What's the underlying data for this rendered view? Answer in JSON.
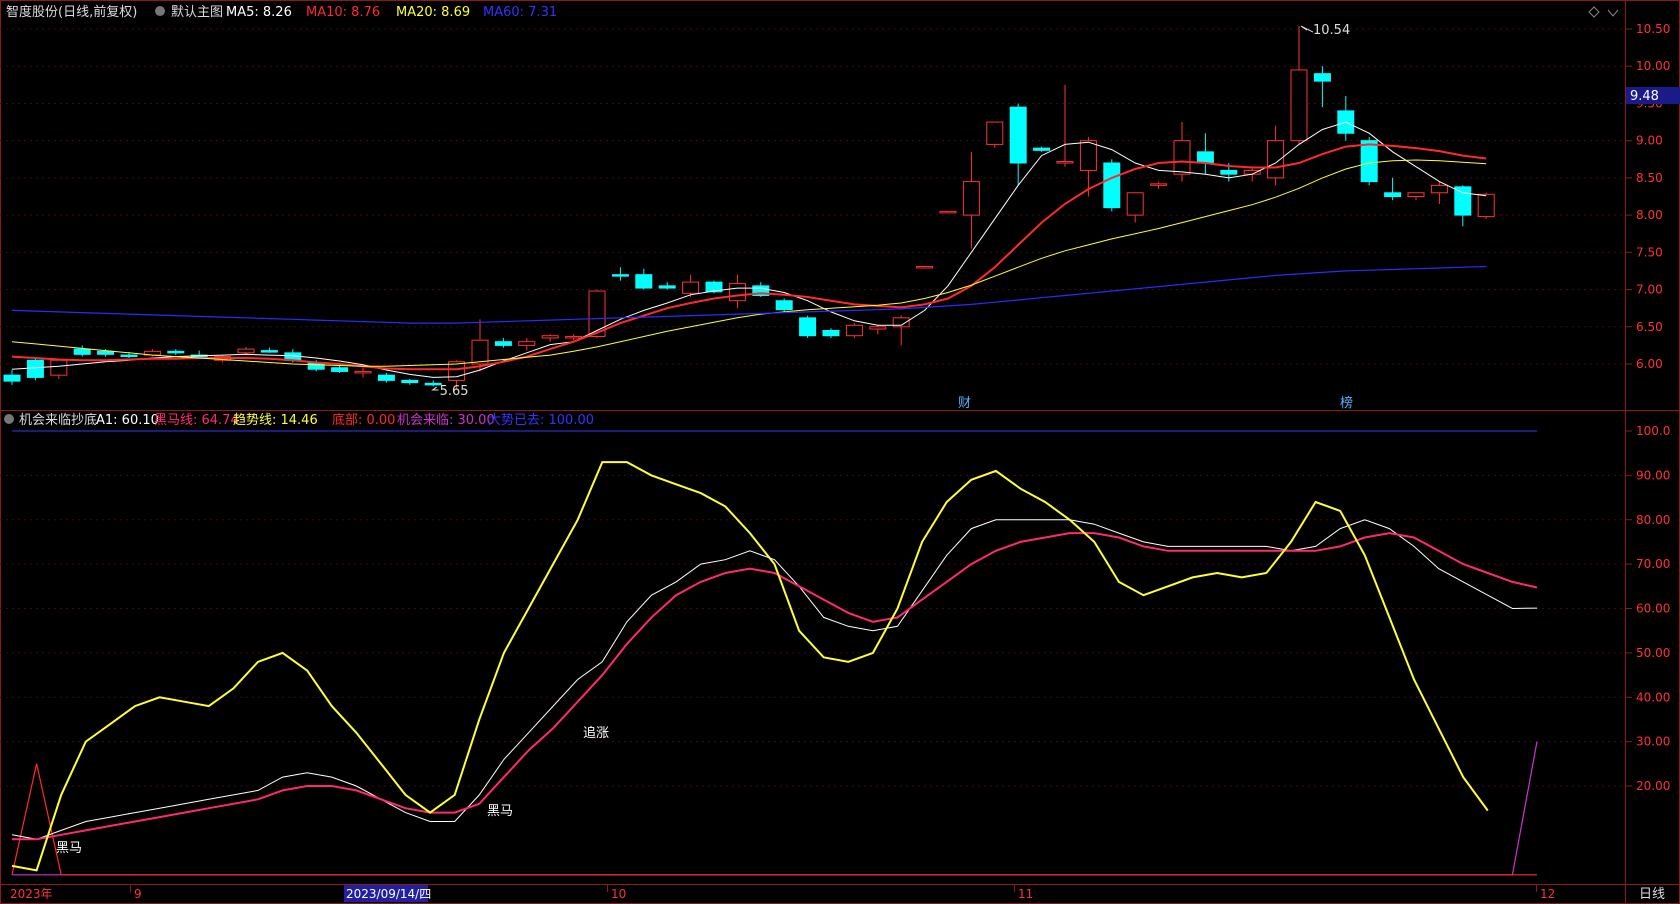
{
  "header": {
    "title": "智度股份(日线,前复权)",
    "main_chart_label": "默认主图",
    "ma": [
      {
        "label": "MA5: 8.26",
        "color": "#ffffff"
      },
      {
        "label": "MA10: 8.76",
        "color": "#ff2a2a"
      },
      {
        "label": "MA20: 8.69",
        "color": "#ffff33"
      },
      {
        "label": "MA60: 7.31",
        "color": "#3333ff"
      }
    ]
  },
  "indicator_header": {
    "name": "机会来临抄底",
    "items": [
      {
        "label": "A1: 60.10",
        "color": "#ffffff"
      },
      {
        "label": "黑马线: 64.74",
        "color": "#ff2a6d"
      },
      {
        "label": "趋势线: 14.46",
        "color": "#ffff33"
      },
      {
        "label": "底部: 0.00",
        "color": "#ff2a2a"
      },
      {
        "label": "机会来临: 30.00",
        "color": "#cc33cc"
      },
      {
        "label": "大势已去: 100.00",
        "color": "#3333ff"
      }
    ]
  },
  "price_axis_labels": [
    "10.50",
    "10.00",
    "9.50",
    "9.00",
    "8.50",
    "8.00",
    "7.50",
    "7.00",
    "6.50",
    "6.00"
  ],
  "indicator_axis_labels": [
    "100.0",
    "90.00",
    "80.00",
    "70.00",
    "60.00",
    "50.00",
    "40.00",
    "30.00",
    "20.00"
  ],
  "current_price_tag": "9.48",
  "annotations": {
    "high": "10.54",
    "low": "5.65",
    "marker_cai": "财",
    "marker_bang": "榜",
    "heima_1": "黑马",
    "heima_2": "黑马",
    "zhuizhang": "追涨"
  },
  "date_axis": {
    "labels": [
      "2023年",
      "9",
      "2023/09/14/四",
      "10",
      "11",
      "12"
    ],
    "period_button": "日线"
  },
  "colors": {
    "up": "#ff3232",
    "down": "#00ffff",
    "ma5": "#ffffff",
    "ma10": "#ff2a2a",
    "ma20": "#ffff33",
    "ma60": "#2b2bff",
    "heima": "#ff2a6d",
    "trend": "#ffff33",
    "a1": "#ffffff",
    "bottom": "#ff2a2a",
    "chance": "#cc33cc",
    "dashi": "#3333ff",
    "frame": "#8b1a1a"
  },
  "chart_data": [
    {
      "type": "candlestick",
      "title": "智度股份(日线,前复权)",
      "ylim": [
        5.5,
        10.7
      ],
      "ohlc": [
        [
          5.85,
          5.92,
          5.72,
          5.77
        ],
        [
          6.05,
          6.08,
          5.78,
          5.82
        ],
        [
          5.85,
          6.07,
          5.8,
          6.05
        ],
        [
          6.2,
          6.25,
          6.1,
          6.13
        ],
        [
          6.17,
          6.2,
          6.1,
          6.13
        ],
        [
          6.12,
          6.16,
          6.08,
          6.1
        ],
        [
          6.12,
          6.2,
          6.1,
          6.17
        ],
        [
          6.17,
          6.2,
          6.12,
          6.15
        ],
        [
          6.12,
          6.18,
          6.08,
          6.1
        ],
        [
          6.05,
          6.12,
          6.02,
          6.1
        ],
        [
          6.15,
          6.23,
          6.12,
          6.2
        ],
        [
          6.18,
          6.22,
          6.15,
          6.17
        ],
        [
          6.15,
          6.2,
          6.02,
          6.05
        ],
        [
          6.02,
          6.05,
          5.9,
          5.93
        ],
        [
          5.95,
          5.98,
          5.88,
          5.9
        ],
        [
          5.88,
          5.95,
          5.82,
          5.9
        ],
        [
          5.85,
          5.88,
          5.75,
          5.78
        ],
        [
          5.78,
          5.8,
          5.72,
          5.75
        ],
        [
          5.74,
          5.78,
          5.7,
          5.73
        ],
        [
          5.78,
          6.05,
          5.65,
          6.03
        ],
        [
          6.0,
          6.6,
          5.9,
          6.32
        ],
        [
          6.3,
          6.35,
          6.22,
          6.25
        ],
        [
          6.25,
          6.35,
          6.18,
          6.3
        ],
        [
          6.35,
          6.4,
          6.3,
          6.38
        ],
        [
          6.35,
          6.4,
          6.32,
          6.37
        ],
        [
          6.37,
          7.0,
          6.35,
          6.98
        ],
        [
          7.2,
          7.3,
          7.12,
          7.18
        ],
        [
          7.2,
          7.28,
          7.0,
          7.02
        ],
        [
          7.05,
          7.1,
          7.0,
          7.02
        ],
        [
          6.95,
          7.2,
          6.9,
          7.1
        ],
        [
          7.1,
          7.12,
          6.95,
          6.97
        ],
        [
          6.85,
          7.2,
          6.75,
          7.08
        ],
        [
          7.05,
          7.1,
          6.9,
          6.92
        ],
        [
          6.85,
          6.88,
          6.7,
          6.73
        ],
        [
          6.62,
          6.65,
          6.35,
          6.38
        ],
        [
          6.45,
          6.48,
          6.35,
          6.38
        ],
        [
          6.38,
          6.55,
          6.35,
          6.52
        ],
        [
          6.47,
          6.52,
          6.4,
          6.5
        ],
        [
          6.5,
          6.65,
          6.25,
          6.62
        ],
        [
          7.3,
          7.32,
          7.3,
          7.31
        ],
        [
          8.05,
          8.05,
          8.05,
          8.05
        ],
        [
          8.0,
          8.85,
          7.55,
          8.45
        ],
        [
          8.95,
          9.25,
          8.9,
          9.25
        ],
        [
          9.45,
          9.5,
          8.4,
          8.7
        ],
        [
          8.9,
          8.92,
          8.85,
          8.87
        ],
        [
          8.7,
          9.75,
          8.65,
          8.72
        ],
        [
          8.6,
          9.05,
          8.25,
          9.0
        ],
        [
          8.7,
          8.75,
          8.05,
          8.1
        ],
        [
          8.0,
          8.3,
          7.9,
          8.3
        ],
        [
          8.4,
          8.45,
          8.35,
          8.42
        ],
        [
          8.55,
          9.25,
          8.45,
          9.0
        ],
        [
          8.85,
          9.1,
          8.55,
          8.7
        ],
        [
          8.6,
          8.7,
          8.45,
          8.55
        ],
        [
          8.55,
          8.65,
          8.45,
          8.6
        ],
        [
          8.5,
          9.2,
          8.4,
          9.0
        ],
        [
          9.0,
          10.54,
          8.95,
          9.95
        ],
        [
          9.9,
          10.0,
          9.45,
          9.8
        ],
        [
          9.4,
          9.6,
          9.0,
          9.1
        ],
        [
          9.0,
          9.05,
          8.4,
          8.45
        ],
        [
          8.3,
          8.5,
          8.2,
          8.25
        ],
        [
          8.25,
          8.3,
          8.2,
          8.3
        ],
        [
          8.3,
          8.45,
          8.15,
          8.4
        ],
        [
          8.38,
          8.4,
          7.85,
          8.0
        ],
        [
          7.98,
          8.3,
          7.95,
          8.28
        ]
      ],
      "series": [
        {
          "name": "MA5",
          "values": [
            5.93,
            5.95,
            5.97,
            6.0,
            6.03,
            6.05,
            6.08,
            6.1,
            6.11,
            6.12,
            6.13,
            6.12,
            6.11,
            6.08,
            6.04,
            5.99,
            5.92,
            5.86,
            5.82,
            5.83,
            5.92,
            6.04,
            6.15,
            6.26,
            6.3,
            6.45,
            6.6,
            6.72,
            6.82,
            6.93,
            6.98,
            7.02,
            7.02,
            6.96,
            6.85,
            6.7,
            6.58,
            6.52,
            6.52,
            6.72,
            7.05,
            7.5,
            7.95,
            8.4,
            8.8,
            8.95,
            8.98,
            8.88,
            8.7,
            8.6,
            8.58,
            8.55,
            8.5,
            8.55,
            8.7,
            8.95,
            9.15,
            9.25,
            9.1,
            8.85,
            8.65,
            8.45,
            8.3,
            8.26
          ]
        },
        {
          "name": "MA10",
          "values": [
            6.1,
            6.08,
            6.06,
            6.05,
            6.05,
            6.06,
            6.07,
            6.07,
            6.08,
            6.08,
            6.08,
            6.07,
            6.05,
            6.02,
            6.0,
            5.97,
            5.94,
            5.93,
            5.93,
            5.93,
            5.97,
            6.03,
            6.1,
            6.2,
            6.3,
            6.42,
            6.55,
            6.65,
            6.75,
            6.82,
            6.88,
            6.92,
            6.95,
            6.93,
            6.9,
            6.85,
            6.8,
            6.78,
            6.76,
            6.8,
            6.88,
            7.05,
            7.3,
            7.6,
            7.9,
            8.15,
            8.35,
            8.5,
            8.62,
            8.7,
            8.72,
            8.7,
            8.66,
            8.64,
            8.64,
            8.7,
            8.82,
            8.92,
            8.95,
            8.93,
            8.9,
            8.86,
            8.8,
            8.76
          ]
        },
        {
          "name": "MA20",
          "values": [
            6.3,
            6.27,
            6.24,
            6.21,
            6.18,
            6.15,
            6.12,
            6.1,
            6.08,
            6.06,
            6.04,
            6.02,
            6.0,
            5.99,
            5.98,
            5.97,
            5.97,
            5.98,
            5.99,
            6.0,
            6.03,
            6.06,
            6.09,
            6.12,
            6.17,
            6.23,
            6.3,
            6.37,
            6.44,
            6.5,
            6.56,
            6.62,
            6.67,
            6.7,
            6.73,
            6.75,
            6.77,
            6.79,
            6.82,
            6.88,
            6.96,
            7.06,
            7.18,
            7.3,
            7.42,
            7.52,
            7.6,
            7.68,
            7.75,
            7.82,
            7.9,
            7.98,
            8.06,
            8.14,
            8.24,
            8.36,
            8.5,
            8.62,
            8.7,
            8.73,
            8.74,
            8.73,
            8.71,
            8.69
          ]
        },
        {
          "name": "MA60",
          "values": [
            6.72,
            6.71,
            6.7,
            6.69,
            6.68,
            6.67,
            6.66,
            6.65,
            6.64,
            6.63,
            6.62,
            6.61,
            6.6,
            6.59,
            6.58,
            6.57,
            6.56,
            6.55,
            6.55,
            6.55,
            6.56,
            6.57,
            6.58,
            6.59,
            6.6,
            6.61,
            6.62,
            6.63,
            6.64,
            6.65,
            6.66,
            6.67,
            6.68,
            6.69,
            6.7,
            6.71,
            6.72,
            6.73,
            6.74,
            6.76,
            6.78,
            6.8,
            6.83,
            6.86,
            6.89,
            6.92,
            6.95,
            6.98,
            7.01,
            7.04,
            7.07,
            7.1,
            7.13,
            7.16,
            7.19,
            7.21,
            7.23,
            7.25,
            7.26,
            7.27,
            7.28,
            7.29,
            7.3,
            7.31
          ]
        }
      ]
    },
    {
      "type": "line",
      "title": "机会来临抄底",
      "ylim": [
        0,
        102
      ],
      "series": [
        {
          "name": "A1",
          "values": [
            9,
            8,
            10,
            12,
            13,
            14,
            15,
            16,
            17,
            18,
            19,
            22,
            23,
            22,
            20,
            17,
            14,
            12,
            12,
            18,
            26,
            32,
            38,
            44,
            48,
            57,
            63,
            66,
            70,
            71,
            73,
            71,
            65,
            58,
            56,
            55,
            56,
            64,
            72,
            78,
            80,
            80,
            80,
            80,
            79,
            77,
            75,
            74,
            74,
            74,
            74,
            74,
            73,
            74,
            78,
            80,
            78,
            74,
            69,
            66,
            63,
            60,
            60.1
          ]
        },
        {
          "name": "黑马线",
          "values": [
            8,
            8,
            9,
            10,
            11,
            12,
            13,
            14,
            15,
            16,
            17,
            19,
            20,
            20,
            19,
            17,
            15,
            14,
            14,
            16,
            22,
            28,
            33,
            39,
            45,
            52,
            58,
            63,
            66,
            68,
            69,
            68,
            65,
            62,
            59,
            57,
            58,
            62,
            66,
            70,
            73,
            75,
            76,
            77,
            77,
            76,
            74,
            73,
            73,
            73,
            73,
            73,
            73,
            73,
            74,
            76,
            77,
            76,
            73,
            70,
            68,
            66,
            64.74
          ]
        },
        {
          "name": "趋势线",
          "values": [
            2,
            1,
            18,
            30,
            34,
            38,
            40,
            39,
            38,
            42,
            48,
            50,
            46,
            38,
            32,
            25,
            18,
            14,
            18,
            35,
            50,
            60,
            70,
            80,
            93,
            93,
            90,
            88,
            86,
            83,
            77,
            70,
            55,
            49,
            48,
            50,
            60,
            75,
            84,
            89,
            91,
            87,
            84,
            80,
            75,
            66,
            63,
            65,
            67,
            68,
            67,
            68,
            75,
            84,
            82,
            72,
            58,
            44,
            33,
            22,
            14.46
          ]
        },
        {
          "name": "底部",
          "values": [
            0,
            25,
            0,
            0,
            0,
            0,
            0,
            0,
            0,
            0,
            0,
            0,
            0,
            0,
            0,
            0,
            0,
            0,
            0,
            0,
            0,
            0,
            0,
            0,
            0,
            0,
            0,
            0,
            0,
            0,
            0,
            0,
            0,
            0,
            0,
            0,
            0,
            0,
            0,
            0,
            0,
            0,
            0,
            0,
            0,
            0,
            0,
            0,
            0,
            0,
            0,
            0,
            0,
            0,
            0,
            0,
            0,
            0,
            0,
            0,
            0,
            0,
            0
          ]
        },
        {
          "name": "机会来临",
          "values": [
            0,
            0,
            0,
            0,
            0,
            0,
            0,
            0,
            0,
            0,
            0,
            0,
            0,
            0,
            0,
            0,
            0,
            0,
            0,
            0,
            0,
            0,
            0,
            0,
            0,
            0,
            0,
            0,
            0,
            0,
            0,
            0,
            0,
            0,
            0,
            0,
            0,
            0,
            0,
            0,
            0,
            0,
            0,
            0,
            0,
            0,
            0,
            0,
            0,
            0,
            0,
            0,
            0,
            0,
            0,
            0,
            0,
            0,
            0,
            0,
            0,
            0,
            30
          ]
        },
        {
          "name": "大势已去",
          "values": [
            100,
            100
          ]
        }
      ]
    }
  ]
}
